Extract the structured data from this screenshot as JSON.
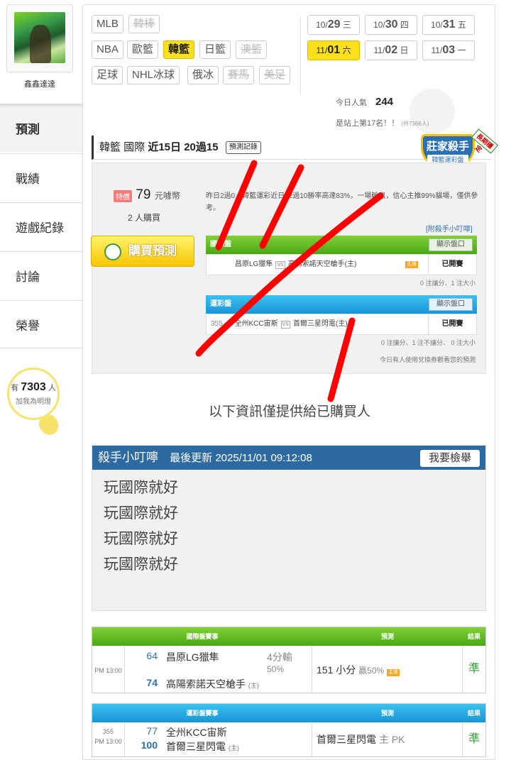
{
  "user": {
    "name": "鑫鑫達達"
  },
  "nav": {
    "items": [
      "預測",
      "戰績",
      "遊戲紀錄",
      "討論",
      "榮譽"
    ]
  },
  "fans": {
    "prefix": "有",
    "count": "7303",
    "suffix": "人",
    "sub": "加我為明燈"
  },
  "sports": [
    "MLB",
    "韓棒",
    "NBA",
    "歐籃",
    "韓籃",
    "日籃",
    "澳籃",
    "足球",
    "NHL冰球",
    "俄冰",
    "賽馬",
    "美足"
  ],
  "dates": [
    {
      "md": "10/",
      "d": "29",
      "w": "三"
    },
    {
      "md": "10/",
      "d": "30",
      "w": "四"
    },
    {
      "md": "10/",
      "d": "31",
      "w": "五"
    },
    {
      "md": "11/",
      "d": "01",
      "w": "六"
    },
    {
      "md": "11/",
      "d": "02",
      "w": "日"
    },
    {
      "md": "11/",
      "d": "03",
      "w": "一"
    }
  ],
  "stats": {
    "pop_label": "今日人氣",
    "pop": "244",
    "rank": "是站上第17名！！",
    "rank_total": "(共7366人)"
  },
  "header": {
    "league": "韓籃 國際",
    "record_a": "近15日",
    "record_b": "20過15",
    "rec_btn": "預測記錄"
  },
  "badge": {
    "title": "莊家殺手",
    "sub": "韓籃運彩盤",
    "ribbon": "長期穩定"
  },
  "price": {
    "hot": "特價",
    "amount": "79",
    "unit": "元噱幣",
    "buyers_n": "2",
    "buyers_unit": "人購買",
    "buy_btn": "購買預測"
  },
  "desc": "昨日2過0，韓籃運彩近日12過10勝率高達83%，一場輸贏，信心主推99%貓場，僅供參考。",
  "link": "[附殺手小叮嚀]",
  "intl": {
    "tab": "國際盤",
    "show": "顯示盤口",
    "away": "昌原LG獵隼",
    "home": "高陽索諾天空槍手(主)",
    "zhu": "主推",
    "status": "已開賽",
    "note": "0 注讓分、1 注大小"
  },
  "sports_lottery": {
    "tab": "運彩盤",
    "show": "顯示盤口",
    "num": "355",
    "away": "全州KCC宙斯",
    "home": "首爾三星閃電(主)",
    "status": "已開賽",
    "note": "0 注讓分、1 注不讓分、 0 注大小",
    "note2": "今日有人使用兌換券觀看您的預測"
  },
  "info_only": "以下資訊僅提供給已購買人",
  "killer": {
    "title": "殺手小叮嚀",
    "updated": "最後更新 2025/11/01 09:12:08",
    "report": "我要檢舉",
    "lines": [
      "玩國際就好",
      "玩國際就好",
      "玩國際就好",
      "玩國際就好"
    ]
  },
  "table1": {
    "h_match": "國際盤賽事",
    "h_pred": "預測",
    "h_res": "結果",
    "time": "PM 13:00",
    "s1": "64",
    "t1": "昌原LG獵隼",
    "s2": "74",
    "t2": "高陽索諾天空槍手",
    "home_mark": "(主)",
    "margin": "4分輸",
    "pct": "50%",
    "pred": "151 小分",
    "pred_sub": "贏50%",
    "zhu": "主推",
    "res": "準"
  },
  "table2": {
    "h_match": "運彩盤賽事",
    "h_pred": "預測",
    "h_res": "結果",
    "num": "355",
    "time": "PM 13:00",
    "s1": "77",
    "t1": "全州KCC宙斯",
    "s2": "100",
    "t2": "首爾三星閃電",
    "home_mark": "(主)",
    "pred": "首爾三星閃電",
    "pred_sub": "主 PK",
    "res": "準"
  },
  "colors": {
    "brand_green": "#4aa813",
    "brand_blue": "#1796d6",
    "highlight": "#fbe01a",
    "header_blue": "#2e6aa2",
    "annotation_red": "#ff0000"
  }
}
